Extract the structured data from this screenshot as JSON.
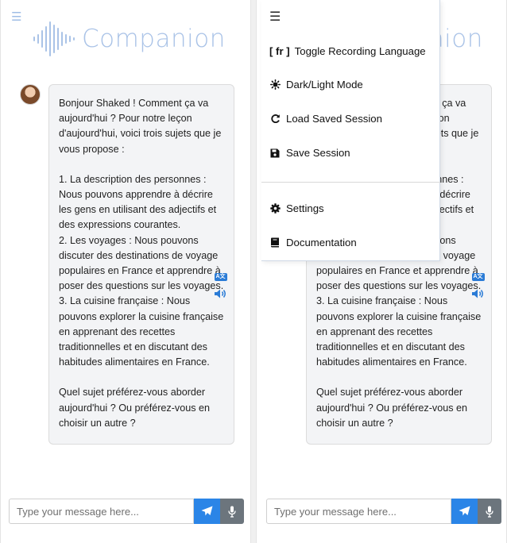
{
  "app": {
    "title": "Companion"
  },
  "chat": {
    "paragraphs": [
      "Bonjour Shaked ! Comment ça va aujourd'hui ? Pour notre leçon d'aujourd'hui, voici trois sujets que je vous propose :",
      "1. La description des personnes : Nous pouvons apprendre à décrire les gens en utilisant des adjectifs et des expressions courantes.\n2. Les voyages : Nous pouvons discuter des destinations de voyage populaires en France et apprendre à poser des questions sur les voyages.\n3. La cuisine française : Nous pouvons explorer la cuisine française en apprenant des recettes traditionnelles et en discutant des habitudes alimentaires en France.",
      "Quel sujet préférez-vous aborder aujourd'hui ? Ou préférez-vous en choisir un autre ?"
    ]
  },
  "input": {
    "placeholder": "Type your message here..."
  },
  "menu": {
    "items": [
      {
        "label": "Toggle Recording Language",
        "tag": "[ fr ]"
      },
      {
        "label": "Dark/Light Mode"
      },
      {
        "label": "Load Saved Session"
      },
      {
        "label": "Save Session"
      },
      {
        "label": "Settings"
      },
      {
        "label": "Documentation"
      }
    ]
  },
  "icons": {
    "menu": "hamburger-icon",
    "translate": "translate-icon",
    "speaker": "speaker-icon",
    "send": "paper-plane-icon",
    "mic": "microphone-icon",
    "theme": "gear-sun-icon",
    "reload": "reload-icon",
    "save": "floppy-disk-icon",
    "settings": "gear-icon",
    "docs": "book-icon"
  },
  "colors": {
    "accent": "#2b85e7",
    "logo": "#aac3e7",
    "mic_button": "#6c757d",
    "bubble": "#f3f4f6"
  }
}
